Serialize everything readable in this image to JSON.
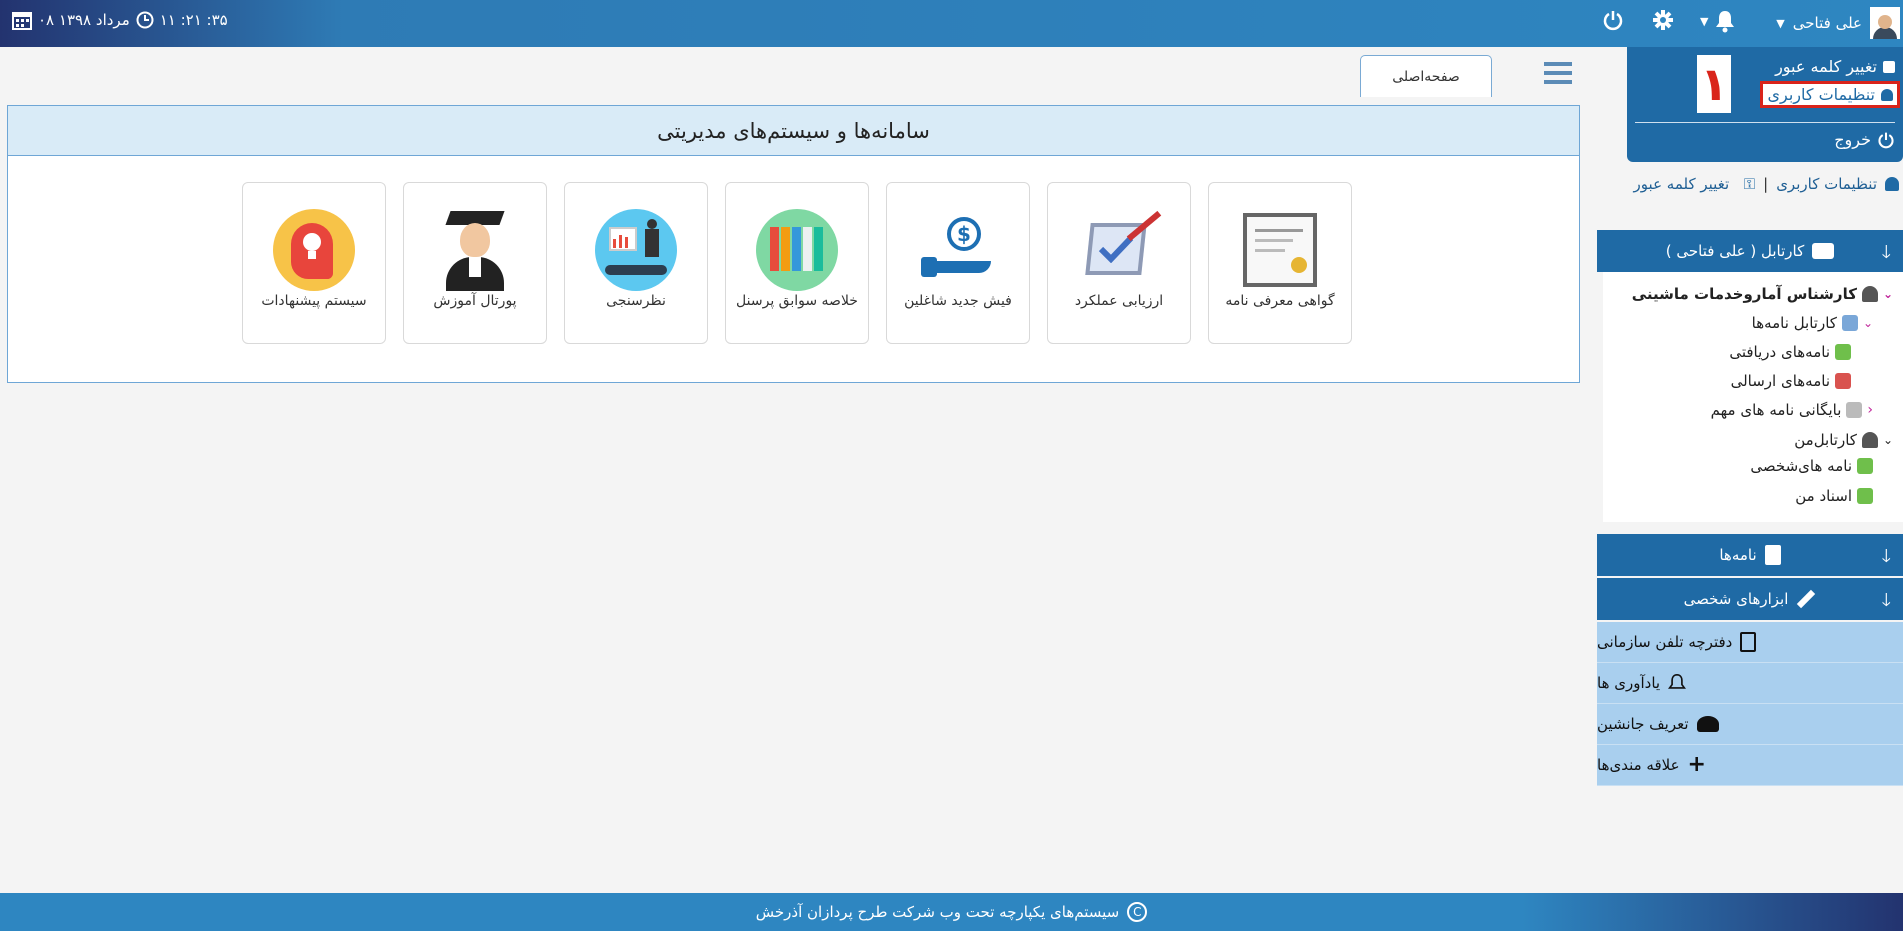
{
  "topbar": {
    "datetime_text": "۰۸ مرداد ۱۳۹۸",
    "time_text": "۱۱ :۲۱ :۳۵",
    "user_name": "علی فتاحی"
  },
  "dropdown": {
    "change_password": "تغییر کلمه عبور",
    "user_settings": "تنظیمات کاربری",
    "logout": "خروج",
    "annotation_number": "۱"
  },
  "user_links": {
    "settings": "تنظیمات کاربری",
    "separator": "|",
    "change_password": "تغییر کلمه عبور"
  },
  "tabs": [
    {
      "label": "صفحه‌اصلی"
    }
  ],
  "main": {
    "title": "سامانه‌ها و سیستم‌های مدیریتی",
    "cards": [
      {
        "label": "گواهی معرفی نامه",
        "icon": "certificate-icon"
      },
      {
        "label": "ارزیابی عملکرد",
        "icon": "evaluation-icon"
      },
      {
        "label": "فیش جدید شاغلین",
        "icon": "payslip-icon"
      },
      {
        "label": "خلاصه سوابق پرسنل",
        "icon": "personnel-records-icon"
      },
      {
        "label": "نظرسنجی",
        "icon": "survey-icon"
      },
      {
        "label": "پورتال آموزش",
        "icon": "education-portal-icon"
      },
      {
        "label": "سیستم پیشنهادات",
        "icon": "suggestions-icon"
      }
    ]
  },
  "sidebar": {
    "kartabl_header": "کارتابل ( علی فتاحی )",
    "tree": {
      "role": "کارشناس آماروخدمات ماشینی",
      "kartabl_letters": "کارتابل نامه‌ها",
      "received": "نامه‌های دریافتی",
      "sent": "نامه‌های ارسالی",
      "archive": "بایگانی نامه های مهم",
      "my_kartabl": "کارتابل‌من",
      "personal_letters": "نامه های‌شخصی",
      "my_docs": "اسناد من"
    },
    "letters_header": "نامه‌ها",
    "tools_header": "ابزارهای شخصی",
    "tools": [
      {
        "label": "دفترچه تلفن سازمانی",
        "icon": "document-icon"
      },
      {
        "label": "یادآوری ها",
        "icon": "bell-icon"
      },
      {
        "label": "تعریف جانشین",
        "icon": "users-icon"
      },
      {
        "label": "علاقه مندی‌ها",
        "icon": "plus-icon"
      }
    ]
  },
  "footer": {
    "text": "سیستم‌های یکپارچه تحت وب شرکت طرح پردازان آذرخش"
  }
}
